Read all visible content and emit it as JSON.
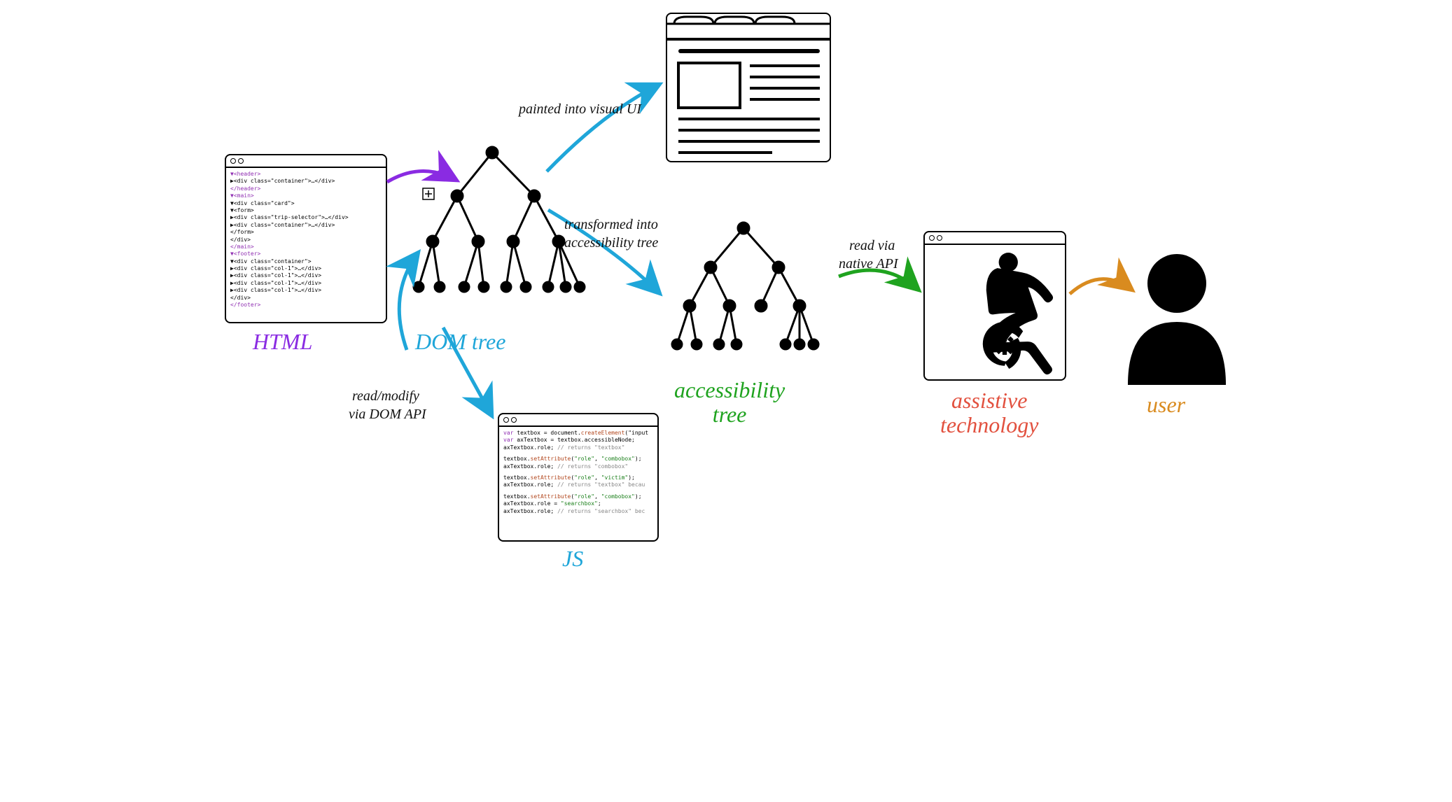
{
  "labels": {
    "html": "HTML",
    "dom_tree": "DOM tree",
    "js": "JS",
    "accessibility_tree": "accessibility\ntree",
    "assistive_technology": "assistive\ntechnology",
    "user": "user",
    "painted": "painted into visual UI",
    "transformed_l1": "transformed into",
    "transformed_l2": "accessibility tree",
    "read_via_l1": "read via",
    "read_via_l2": "native API",
    "read_modify_l1": "read/modify",
    "read_modify_l2": "via DOM API"
  },
  "colors": {
    "html": "#8a2be2",
    "dom": "#1fa6d9",
    "acc": "#1fa31f",
    "at": "#e2513f",
    "user": "#d98b1f",
    "js": "#1fa6d9",
    "ink": "#111"
  },
  "html_snippet": {
    "l1": "▼<header>",
    "l2": "  ▶<div class=\"container\">…</div>",
    "l3": " </header>",
    "l4": "▼<main>",
    "l5": "  ▼<div class=\"card\">",
    "l6": "    ▼<form>",
    "l7": "      ▶<div class=\"trip-selector\">…</div>",
    "l8": "      ▶<div class=\"container\">…</div>",
    "l9": "     </form>",
    "l10": "   </div>",
    "l11": " </main>",
    "l12": "▼<footer>",
    "l13": "  ▼<div class=\"container\">",
    "l14": "    ▶<div class=\"col-1\">…</div>",
    "l15": "    ▶<div class=\"col-1\">…</div>",
    "l16": "    ▶<div class=\"col-1\">…</div>",
    "l17": "    ▶<div class=\"col-1\">…</div>",
    "l18": "   </div>",
    "l19": " </footer>"
  },
  "js_snippet": {
    "l1_a": "var",
    "l1_b": " textbox = document.",
    "l1_c": "createElement",
    "l1_d": "(\"input",
    "l2_a": "var",
    "l2_b": " axTextbox = textbox.accessibleNode;",
    "l3_a": "axTextbox.role;  ",
    "l3_b": "// returns \"textbox\"",
    "l4_a": "textbox.",
    "l4_b": "setAttribute",
    "l4_c": "(",
    "l4_d": "\"role\"",
    "l4_e": ", ",
    "l4_f": "\"combobox\"",
    "l4_g": ");",
    "l5_a": "axTextbox.role;  ",
    "l5_b": "// returns \"combobox\"",
    "l6_a": "textbox.",
    "l6_b": "setAttribute",
    "l6_c": "(",
    "l6_d": "\"role\"",
    "l6_e": ", ",
    "l6_f": "\"victim\"",
    "l6_g": ");",
    "l7_a": "axTextbox.role;  ",
    "l7_b": "// returns \"textbox\" becau",
    "l8_a": "textbox.",
    "l8_b": "setAttribute",
    "l8_c": "(",
    "l8_d": "\"role\"",
    "l8_e": ", ",
    "l8_f": "\"combobox\"",
    "l8_g": ");",
    "l9_a": "axTextbox.role = ",
    "l9_b": "\"searchbox\"",
    "l9_c": ";",
    "l10_a": "axTextbox.role;  ",
    "l10_b": "// returns \"searchbox\" bec"
  }
}
